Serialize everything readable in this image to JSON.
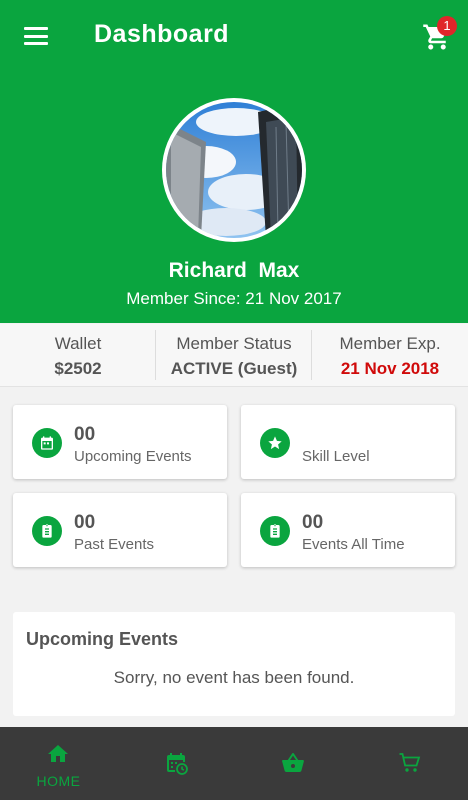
{
  "header": {
    "title": "Dashboard",
    "cart_badge": "1"
  },
  "profile": {
    "name": "Richard  Max",
    "member_since": "Member Since: 21 Nov 2017"
  },
  "stats": [
    {
      "label": "Wallet",
      "value": "$2502"
    },
    {
      "label": "Member Status",
      "value": "ACTIVE (Guest)"
    },
    {
      "label": "Member Exp.",
      "value": "21 Nov 2018"
    }
  ],
  "cards": [
    {
      "number": "00",
      "caption": "Upcoming Events",
      "icon": "calendar-icon"
    },
    {
      "number": "",
      "caption": "Skill Level",
      "icon": "star-icon"
    },
    {
      "number": "00",
      "caption": "Past Events",
      "icon": "clipboard-icon"
    },
    {
      "number": "00",
      "caption": "Events All Time",
      "icon": "clipboard-icon"
    }
  ],
  "upcoming": {
    "title": "Upcoming Events",
    "empty_message": "Sorry, no event has been found."
  },
  "nav": [
    {
      "label": "HOME",
      "icon": "home-icon"
    },
    {
      "label": "",
      "icon": "calendar-clock-icon"
    },
    {
      "label": "",
      "icon": "basket-icon"
    },
    {
      "label": "",
      "icon": "cart-icon"
    }
  ],
  "colors": {
    "primary_green": "#0aa53f",
    "expiry_red": "#d00a0a",
    "nav_background": "#3a3a3a",
    "badge_red": "#e0262a"
  }
}
